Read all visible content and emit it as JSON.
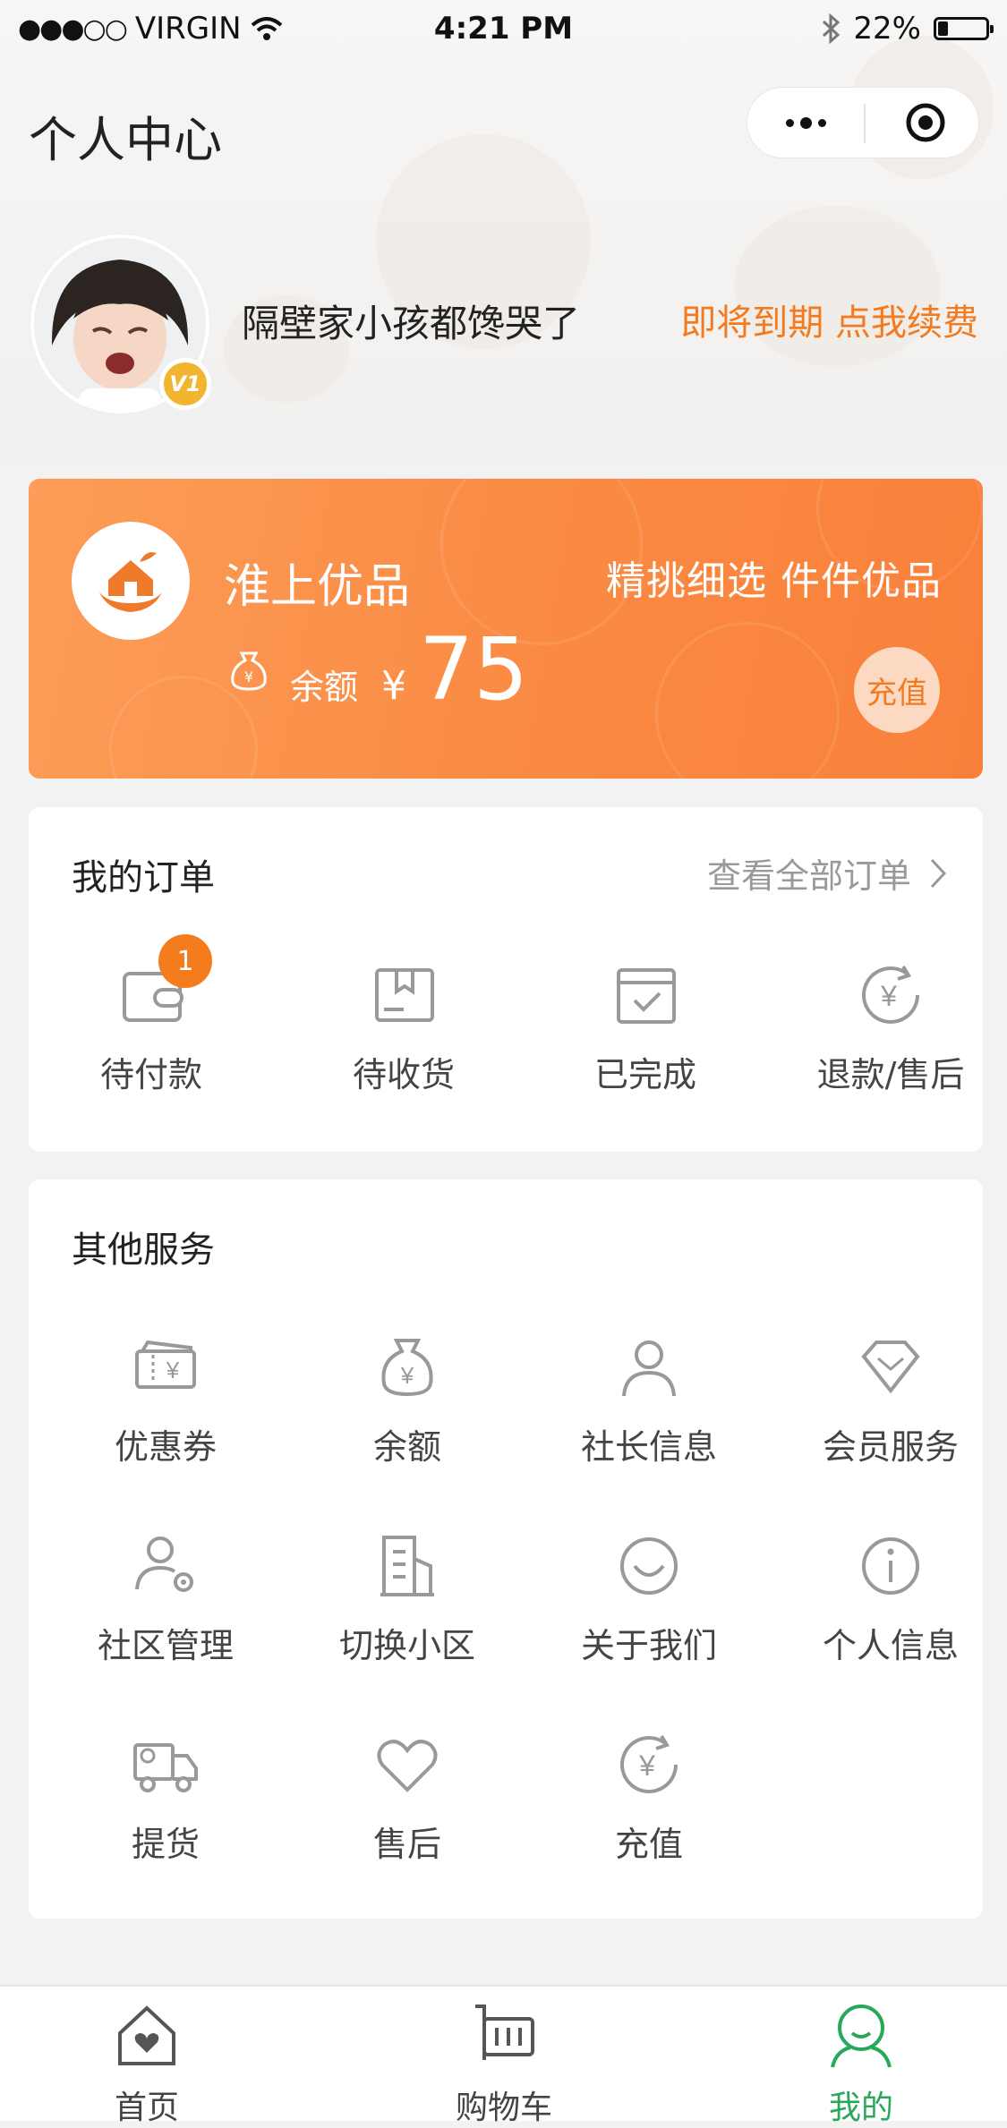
{
  "status_bar": {
    "signal": "●●●○○",
    "carrier": "VIRGIN",
    "time": "4:21 PM",
    "battery": "22%",
    "battery_level": 0.22
  },
  "nav": {
    "title": "个人中心"
  },
  "profile": {
    "username": "隔壁家小孩都馋哭了",
    "level_badge": "V1",
    "renew_text": "即将到期 点我续费"
  },
  "card": {
    "brand": "淮上优品",
    "slogan": "精挑细选  件件优品",
    "balance_label": "余额",
    "currency": "¥",
    "balance": "75",
    "recharge_label": "充值"
  },
  "orders": {
    "title": "我的订单",
    "view_all": "查看全部订单",
    "items": [
      {
        "label": "待付款",
        "icon": "wallet-icon",
        "badge": "1"
      },
      {
        "label": "待收货",
        "icon": "package-icon"
      },
      {
        "label": "已完成",
        "icon": "calendar-check-icon"
      },
      {
        "label": "退款/售后",
        "icon": "refund-icon"
      }
    ]
  },
  "services": {
    "title": "其他服务",
    "items": [
      {
        "label": "优惠券",
        "icon": "coupon-icon"
      },
      {
        "label": "余额",
        "icon": "money-bag-icon"
      },
      {
        "label": "社长信息",
        "icon": "user-icon"
      },
      {
        "label": "会员服务",
        "icon": "diamond-icon"
      },
      {
        "label": "社区管理",
        "icon": "user-settings-icon"
      },
      {
        "label": "切换小区",
        "icon": "building-icon"
      },
      {
        "label": "关于我们",
        "icon": "smile-icon"
      },
      {
        "label": "个人信息",
        "icon": "info-icon"
      },
      {
        "label": "提货",
        "icon": "truck-icon"
      },
      {
        "label": "售后",
        "icon": "heart-icon"
      },
      {
        "label": "充值",
        "icon": "recharge-icon"
      }
    ]
  },
  "tabbar": {
    "items": [
      {
        "label": "首页",
        "icon": "home-icon",
        "active": false
      },
      {
        "label": "购物车",
        "icon": "cart-icon",
        "active": false
      },
      {
        "label": "我的",
        "icon": "profile-icon",
        "active": true
      }
    ]
  },
  "colors": {
    "accent": "#f47a20",
    "card_orange": "#fa8a43",
    "tab_active": "#2aa85a",
    "badge": "#f57c1d"
  }
}
